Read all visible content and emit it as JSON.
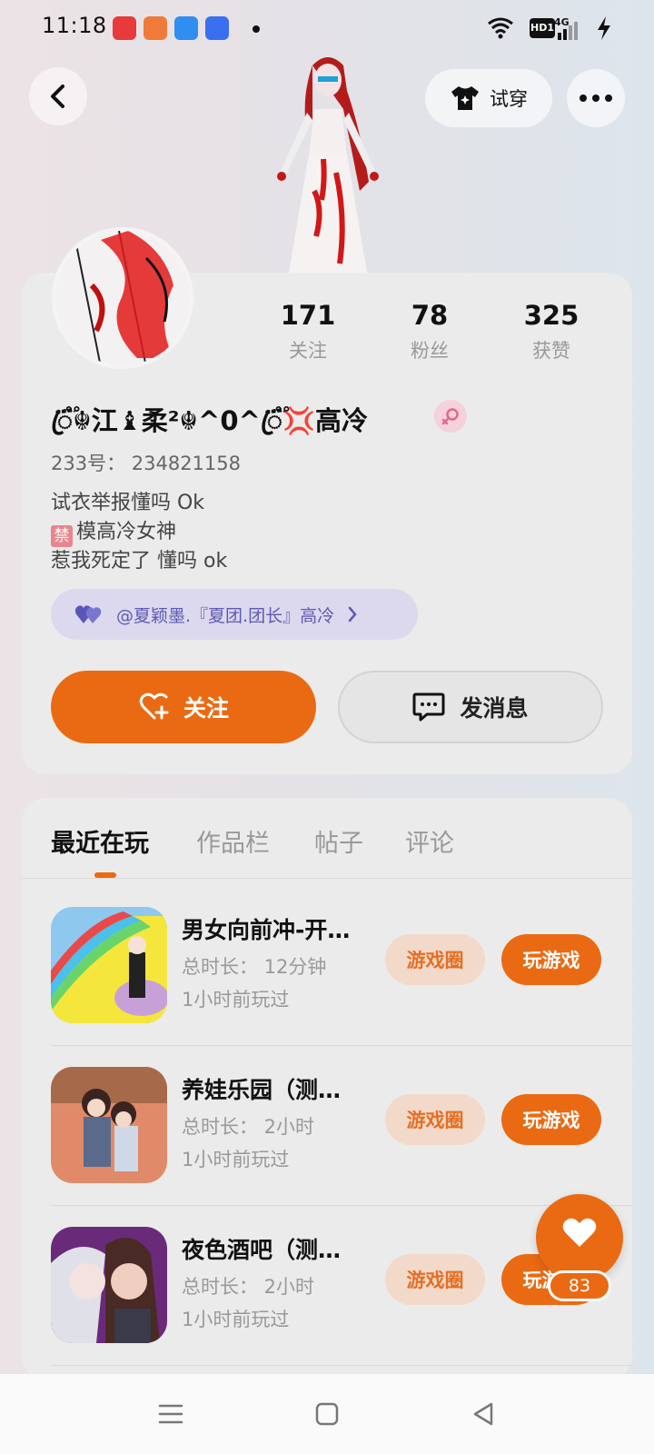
{
  "status_bar": {
    "time": "11:18",
    "hd_label": "HD1",
    "network_label": "4G"
  },
  "header": {
    "tryon_label": "试穿"
  },
  "profile": {
    "stats": [
      {
        "value": "171",
        "label": "关注"
      },
      {
        "value": "78",
        "label": "粉丝"
      },
      {
        "value": "325",
        "label": "获赞"
      }
    ],
    "nickname": "ꦿ֟፝☬江♝柔²☬^0^ꦿ֟፝💢高冷",
    "uid": "233号：  234821158",
    "bio_line1": "试衣举报懂吗 Ok",
    "bio_jin": "禁",
    "bio_line2": "模高冷女神",
    "bio_line3": "惹我死定了 懂吗 ok",
    "team": "@夏颖墨.『夏团.团长』高冷",
    "follow_label": "关注",
    "message_label": "发消息"
  },
  "tabs": [
    {
      "label": "最近在玩",
      "active": true
    },
    {
      "label": "作品栏",
      "active": false
    },
    {
      "label": "帖子",
      "active": false
    },
    {
      "label": "评论",
      "active": false
    }
  ],
  "games": [
    {
      "title": "男女向前冲-开…",
      "duration": "总时长：  12分钟",
      "last_played": "1小时前玩过",
      "circle_label": "游戏圈",
      "play_label": "玩游戏"
    },
    {
      "title": "养娃乐园（测…",
      "duration": "总时长：  2小时",
      "last_played": "1小时前玩过",
      "circle_label": "游戏圈",
      "play_label": "玩游戏"
    },
    {
      "title": "夜色酒吧（测…",
      "duration": "总时长：  2小时",
      "last_played": "1小时前玩过",
      "circle_label": "游戏圈",
      "play_label": "玩游戏"
    }
  ],
  "like": {
    "count": "83"
  },
  "colors": {
    "accent": "#ea6a13",
    "accent_soft": "#f2d9c9",
    "team_bg": "#dcd8ee",
    "team_text": "#5c5ab2"
  }
}
